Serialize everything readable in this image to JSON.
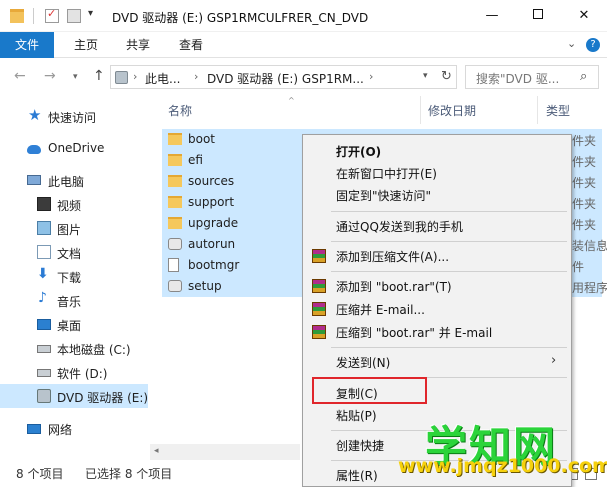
{
  "window": {
    "title": "DVD 驱动器 (E:) GSP1RMCULFRER_CN_DVD",
    "minimize": "—",
    "close": "✕",
    "dropdown": "▾"
  },
  "ribbon": {
    "tabs": [
      "文件",
      "主页",
      "共享",
      "查看"
    ],
    "chevron": "⌄",
    "help": "?"
  },
  "address": {
    "back": "←",
    "forward": "→",
    "recent": "▾",
    "up": "↑",
    "crumbs": [
      "此电...",
      "DVD 驱动器 (E:) GSP1RM..."
    ],
    "sep": "›",
    "dropdown": "▾",
    "refresh": "↻",
    "search_placeholder": "搜索\"DVD 驱...",
    "search_icon": "⌕"
  },
  "sidebar": {
    "items": [
      {
        "label": "快速访问",
        "icon": "star-icon"
      },
      {
        "label": "OneDrive",
        "icon": "cloud-icon"
      },
      {
        "label": "此电脑",
        "icon": "computer-icon"
      },
      {
        "label": "视频",
        "icon": "video-icon"
      },
      {
        "label": "图片",
        "icon": "picture-icon"
      },
      {
        "label": "文档",
        "icon": "document-icon"
      },
      {
        "label": "下载",
        "icon": "download-icon"
      },
      {
        "label": "音乐",
        "icon": "music-icon"
      },
      {
        "label": "桌面",
        "icon": "desktop-icon"
      },
      {
        "label": "本地磁盘 (C:)",
        "icon": "disk-icon"
      },
      {
        "label": "软件 (D:)",
        "icon": "disk-icon"
      },
      {
        "label": "DVD 驱动器 (E:)",
        "icon": "dvd-icon"
      },
      {
        "label": "网络",
        "icon": "network-icon"
      }
    ],
    "star": "★",
    "download_glyph": "⬇",
    "music_glyph": "♪",
    "expand": "›"
  },
  "columns": {
    "name": "名称",
    "modified": "修改日期",
    "type": "类型",
    "sort": "^"
  },
  "files": [
    {
      "name": "boot",
      "kind": "folder",
      "type": "件夹"
    },
    {
      "name": "efi",
      "kind": "folder",
      "type": "件夹"
    },
    {
      "name": "sources",
      "kind": "folder",
      "type": "件夹"
    },
    {
      "name": "support",
      "kind": "folder",
      "type": "件夹"
    },
    {
      "name": "upgrade",
      "kind": "folder",
      "type": "件夹"
    },
    {
      "name": "autorun",
      "kind": "settings",
      "type": "装信息"
    },
    {
      "name": "bootmgr",
      "kind": "file",
      "type": "件"
    },
    {
      "name": "setup",
      "kind": "app",
      "type": "用程序"
    }
  ],
  "scroll_left": "◂",
  "status": {
    "count": "8 个项目",
    "selected": "已选择 8 个项目"
  },
  "context_menu": {
    "open": "打开(O)",
    "open_new_window": "在新窗口中打开(E)",
    "pin_quick": "固定到\"快速访问\"",
    "send_qq": "通过QQ发送到我的手机",
    "add_archive": "添加到压缩文件(A)...",
    "add_boot_rar": "添加到 \"boot.rar\"(T)",
    "compress_email": "压缩并 E-mail...",
    "compress_boot_email": "压缩到 \"boot.rar\" 并 E-mail",
    "send_to": "发送到(N)",
    "send_to_arrow": "›",
    "copy": "复制(C)",
    "paste": "粘贴(P)",
    "create_shortcut": "创建快捷",
    "properties": "属性(R)"
  },
  "watermark": {
    "title": "学知网",
    "url": "www.jmqz1000.com"
  },
  "colors": {
    "accent": "#1979ca",
    "selection": "#cce8ff",
    "highlight": "#e0262b",
    "watermark_green": "#2bd43a",
    "watermark_yellow": "#f6d10d"
  }
}
